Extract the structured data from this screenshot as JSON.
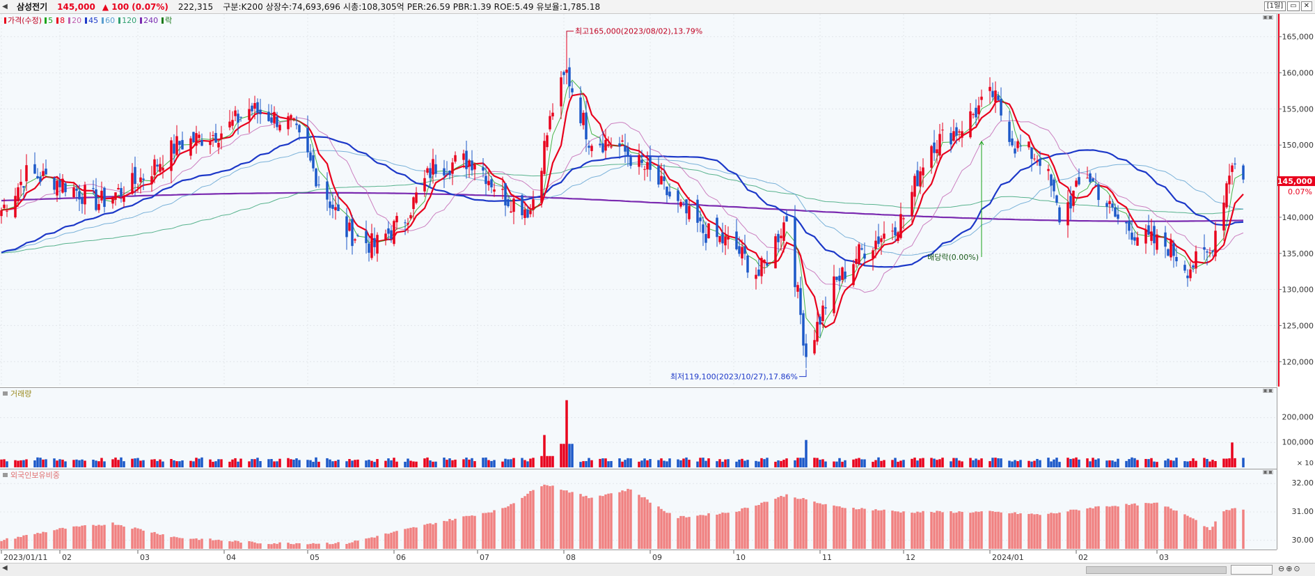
{
  "header": {
    "name": "삼성전기",
    "price": "145,000",
    "change": "▲ 100",
    "change_pct": "(0.07%)",
    "volume": "222,315",
    "info": "구분:K200 상장수:74,693,696 시총:108,305억 PER:26.59 PBR:1.39 ROE:5.49 유보율:1,785.18",
    "period_button": "[1일]",
    "nav_left": "◀"
  },
  "price_legend": {
    "label": "가격(수정)",
    "items": [
      {
        "label": "5",
        "color": "#1aa41a"
      },
      {
        "label": "8",
        "color": "#e8001c"
      },
      {
        "label": "20",
        "color": "#c060b0"
      },
      {
        "label": "45",
        "color": "#1c38c8"
      },
      {
        "label": "60",
        "color": "#5a9fd0"
      },
      {
        "label": "120",
        "color": "#30a070"
      },
      {
        "label": "240",
        "color": "#7a2ab0"
      },
      {
        "label": "락",
        "color": "#1a7a1a"
      }
    ]
  },
  "volume_legend": {
    "label": "거래량"
  },
  "foreign_legend": {
    "label": "외국인보유비중"
  },
  "annotations": {
    "high": "최고165,000(2023/08/02),13.79%",
    "low": "최저119,100(2023/10/27),17.86%",
    "dividend": "배당락(0.00%)"
  },
  "current": {
    "price_label": "145,000",
    "pct_label": "0.07%"
  },
  "axes": {
    "price_ticks": [
      "165,000",
      "160,000",
      "155,000",
      "150,000",
      "145,000",
      "140,000",
      "135,000",
      "130,000",
      "125,000",
      "120,000"
    ],
    "volume_ticks": [
      "200,000",
      "100,000",
      "× 10"
    ],
    "foreign_ticks": [
      "32.00",
      "31.00",
      "30.00"
    ],
    "x_labels": [
      "2023/01/11",
      "02",
      "03",
      "04",
      "05",
      "06",
      "07",
      "08",
      "09",
      "10",
      "11",
      "12",
      "2024/01",
      "02",
      "03"
    ]
  },
  "chart_data": {
    "type": "candlestick",
    "title": "삼성전기",
    "x_range": [
      "2023/01/11",
      "2024/03"
    ],
    "price_ylim": [
      118000,
      167000
    ],
    "price_keypoints": [
      [
        "2023/01/11",
        141000
      ],
      [
        "2023/01/20",
        146000
      ],
      [
        "2023/02/01",
        145000
      ],
      [
        "2023/02/15",
        142000
      ],
      [
        "2023/03/01",
        145000
      ],
      [
        "2023/03/15",
        150000
      ],
      [
        "2023/04/01",
        152000
      ],
      [
        "2023/04/10",
        155000
      ],
      [
        "2023/04/25",
        153000
      ],
      [
        "2023/05/05",
        145000
      ],
      [
        "2023/05/15",
        138000
      ],
      [
        "2023/05/25",
        136000
      ],
      [
        "2023/06/05",
        140000
      ],
      [
        "2023/06/15",
        147000
      ],
      [
        "2023/06/30",
        148000
      ],
      [
        "2023/07/10",
        143000
      ],
      [
        "2023/07/20",
        141000
      ],
      [
        "2023/07/28",
        155000
      ],
      [
        "2023/08/02",
        160000
      ],
      [
        "2023/08/10",
        151000
      ],
      [
        "2023/08/20",
        150000
      ],
      [
        "2023/09/01",
        146000
      ],
      [
        "2023/09/10",
        142000
      ],
      [
        "2023/09/20",
        138000
      ],
      [
        "2023/10/01",
        136000
      ],
      [
        "2023/10/10",
        132000
      ],
      [
        "2023/10/20",
        140000
      ],
      [
        "2023/10/27",
        121000
      ],
      [
        "2023/11/05",
        130000
      ],
      [
        "2023/11/15",
        135000
      ],
      [
        "2023/11/25",
        138000
      ],
      [
        "2023/12/01",
        140000
      ],
      [
        "2023/12/10",
        150000
      ],
      [
        "2023/12/20",
        152000
      ],
      [
        "2024/01/02",
        157000
      ],
      [
        "2024/01/10",
        150000
      ],
      [
        "2024/01/20",
        148000
      ],
      [
        "2024/01/26",
        140000
      ],
      [
        "2024/02/05",
        146000
      ],
      [
        "2024/02/15",
        140000
      ],
      [
        "2024/02/25",
        137000
      ],
      [
        "2024/03/05",
        136000
      ],
      [
        "2024/03/12",
        133000
      ],
      [
        "2024/03/20",
        135000
      ],
      [
        "2024/03/28",
        148000
      ],
      [
        "2024/04/01",
        145000
      ]
    ],
    "high": {
      "date": "2023/08/02",
      "value": 165000
    },
    "low": {
      "date": "2023/10/27",
      "value": 119100
    },
    "last_close": 145000,
    "moving_averages": [
      "5",
      "8",
      "20",
      "45",
      "60",
      "120",
      "240"
    ],
    "volume_ylim": [
      0,
      280000
    ],
    "volume_peaks": [
      [
        "2023/07/25",
        130000
      ],
      [
        "2023/08/02",
        270000
      ],
      [
        "2023/10/27",
        110000
      ],
      [
        "2024/03/28",
        100000
      ]
    ],
    "foreign_ratio_ylim": [
      29.7,
      32.3
    ],
    "foreign_ratio_keypoints": [
      [
        "2023/01/11",
        30.0
      ],
      [
        "2023/02/01",
        30.4
      ],
      [
        "2023/02/20",
        30.6
      ],
      [
        "2023/03/15",
        30.1
      ],
      [
        "2023/04/15",
        29.9
      ],
      [
        "2023/05/15",
        29.9
      ],
      [
        "2023/06/15",
        30.6
      ],
      [
        "2023/07/10",
        31.1
      ],
      [
        "2023/07/25",
        32.0
      ],
      [
        "2023/08/10",
        31.5
      ],
      [
        "2023/08/25",
        31.8
      ],
      [
        "2023/09/10",
        30.8
      ],
      [
        "2023/10/01",
        31.0
      ],
      [
        "2023/10/20",
        31.6
      ],
      [
        "2023/11/05",
        31.2
      ],
      [
        "2023/12/01",
        31.0
      ],
      [
        "2024/01/01",
        31.0
      ],
      [
        "2024/01/20",
        30.9
      ],
      [
        "2024/02/10",
        31.2
      ],
      [
        "2024/03/01",
        31.3
      ],
      [
        "2024/03/12",
        30.9
      ],
      [
        "2024/03/20",
        30.4
      ],
      [
        "2024/03/26",
        31.1
      ],
      [
        "2024/04/01",
        31.1
      ]
    ]
  }
}
